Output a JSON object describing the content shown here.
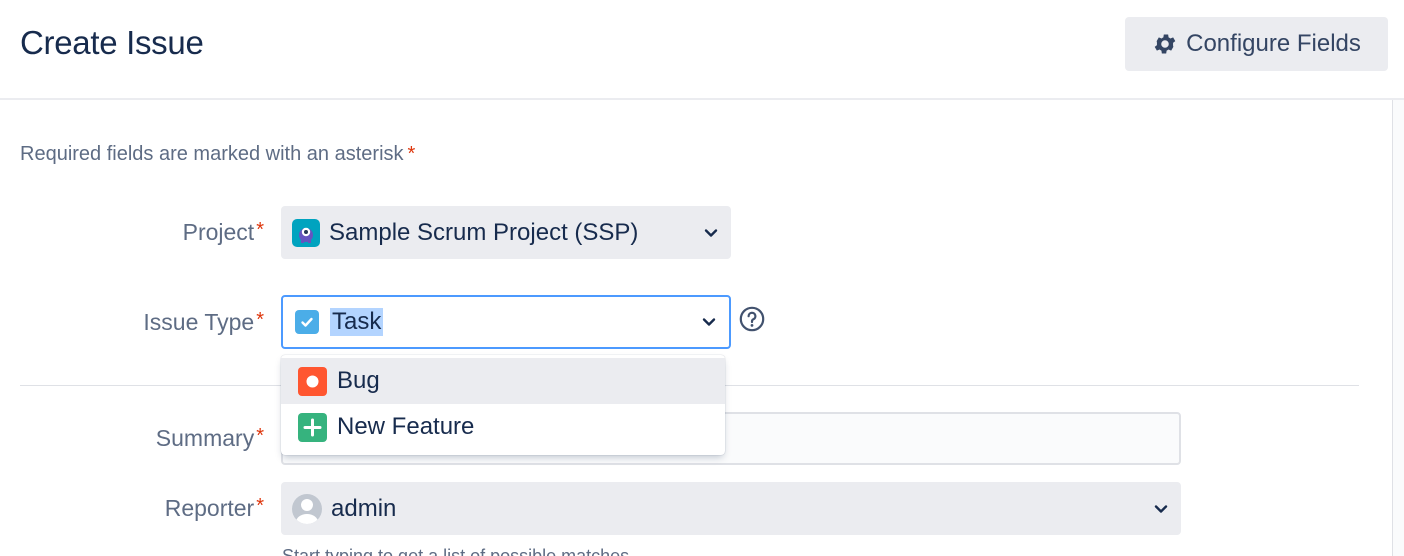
{
  "header": {
    "title": "Create Issue",
    "configure_label": "Configure Fields"
  },
  "form": {
    "required_hint": "Required fields are marked with an asterisk",
    "asterisk": "*",
    "project": {
      "label": "Project",
      "value": "Sample Scrum Project (SSP)"
    },
    "issue_type": {
      "label": "Issue Type",
      "value": "Task",
      "options": [
        {
          "label": "Bug",
          "icon": "bug-icon",
          "color": "#ff5630"
        },
        {
          "label": "New Feature",
          "icon": "new-feature-icon",
          "color": "#36b37e"
        }
      ]
    },
    "summary": {
      "label": "Summary",
      "value": ""
    },
    "reporter": {
      "label": "Reporter",
      "value": "admin"
    },
    "reporter_helper": "Start typing to get a list of possible matches."
  },
  "colors": {
    "accent": "#4c9aff",
    "required": "#de350b",
    "task": "#4bade8",
    "project_icon": "#00a3bf"
  }
}
